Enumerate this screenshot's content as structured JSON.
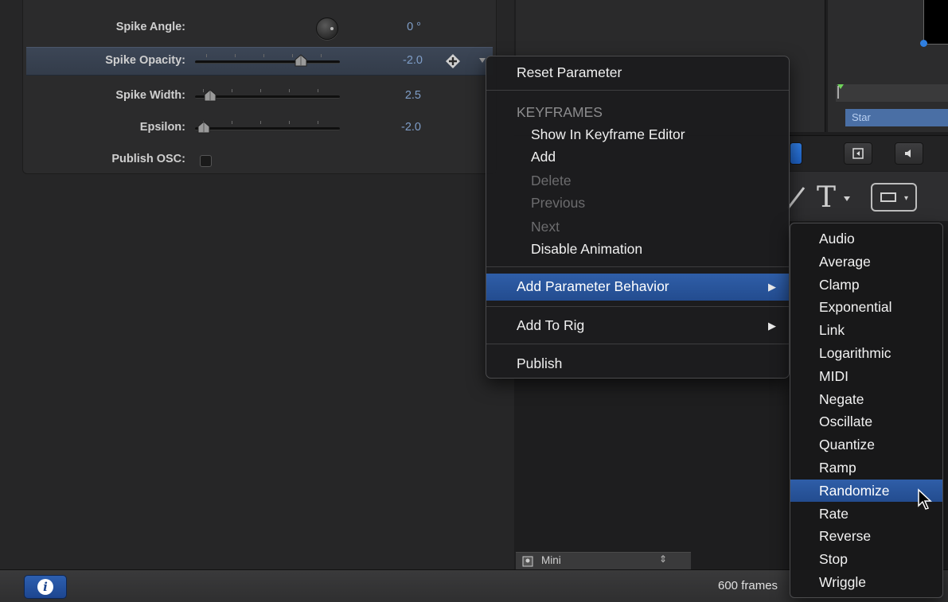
{
  "inspector": {
    "rows": [
      {
        "label": "Spike Angle:",
        "value": "0 °",
        "control": "dial"
      },
      {
        "label": "Spike Opacity:",
        "value": "-2.0",
        "control": "slider",
        "selected": true
      },
      {
        "label": "Spike Width:",
        "value": "2.5",
        "control": "slider"
      },
      {
        "label": "Epsilon:",
        "value": "-2.0",
        "control": "slider"
      },
      {
        "label": "Publish OSC:",
        "value": "",
        "control": "checkbox"
      }
    ]
  },
  "timeline": {
    "clip_label": "Star"
  },
  "mini_popup": {
    "label": "Mini"
  },
  "status_bar": {
    "frames_label": "600 frames"
  },
  "context_menu": {
    "reset": "Reset Parameter",
    "keyframes_header": "KEYFRAMES",
    "show_in_editor": "Show In Keyframe Editor",
    "add": "Add",
    "delete": "Delete",
    "previous": "Previous",
    "next": "Next",
    "disable_animation": "Disable Animation",
    "add_parameter_behavior": "Add Parameter Behavior",
    "add_to_rig": "Add To Rig",
    "publish": "Publish"
  },
  "submenu": {
    "items": [
      "Audio",
      "Average",
      "Clamp",
      "Exponential",
      "Link",
      "Logarithmic",
      "MIDI",
      "Negate",
      "Oscillate",
      "Quantize",
      "Ramp",
      "Randomize",
      "Rate",
      "Reverse",
      "Stop",
      "Wriggle"
    ],
    "highlighted": "Randomize"
  },
  "colors": {
    "highlight": "#2f5ea8",
    "value_text": "#7f9ec8"
  }
}
